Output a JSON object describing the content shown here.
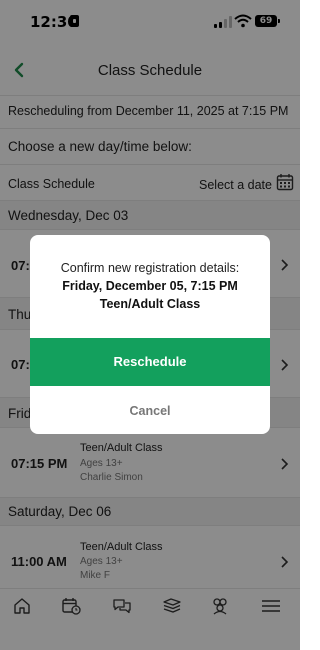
{
  "status": {
    "time": "12:30",
    "battery": "69"
  },
  "nav": {
    "title": "Class Schedule"
  },
  "rescheduling_text": "Rescheduling from December 11, 2025 at 7:15 PM",
  "choose_text": "Choose a new day/time below:",
  "schedule_header": {
    "label": "Class Schedule",
    "select_date": "Select a date"
  },
  "days": [
    {
      "header": "Wednesday, Dec 03",
      "classes": [
        {
          "time": "07:"
        }
      ]
    },
    {
      "header": "Thu",
      "classes": [
        {
          "time": "07:"
        }
      ]
    },
    {
      "header": "Frid",
      "classes": [
        {
          "time": "07:15 PM",
          "name": "Teen/Adult Class",
          "ages": "Ages 13+",
          "instructor": "Charlie Simon"
        }
      ]
    },
    {
      "header": "Saturday, Dec 06",
      "classes": [
        {
          "time": "11:00 AM",
          "name": "Teen/Adult Class",
          "ages": "Ages 13+",
          "instructor": "Mike F"
        }
      ]
    }
  ],
  "modal": {
    "line1": "Confirm new registration details:",
    "line2": "Friday, December 05, 7:15 PM",
    "line3": "Teen/Adult Class",
    "confirm_label": "Reschedule",
    "cancel_label": "Cancel"
  },
  "tabs": [
    {
      "icon": "home-icon"
    },
    {
      "icon": "calendar-clock-icon"
    },
    {
      "icon": "chat-icon"
    },
    {
      "icon": "book-stack-icon"
    },
    {
      "icon": "community-icon"
    },
    {
      "icon": "menu-icon"
    }
  ],
  "colors": {
    "accent": "#13a05d",
    "back_arrow": "#1f8a4c"
  }
}
